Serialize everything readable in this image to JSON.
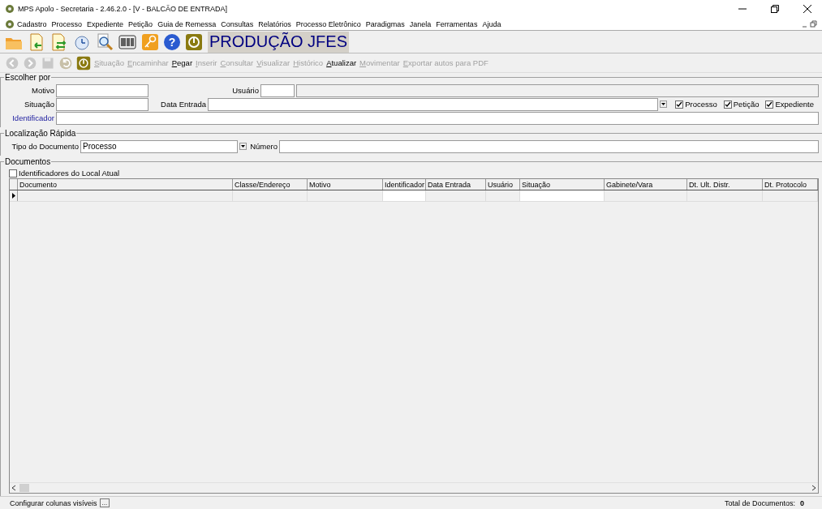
{
  "window": {
    "title": "MPS Apolo - Secretaria - 2.46.2.0 - [V - BALCÃO DE ENTRADA]"
  },
  "menu": [
    "Cadastro",
    "Processo",
    "Expediente",
    "Petição",
    "Guia de Remessa",
    "Consultas",
    "Relatórios",
    "Processo Eletrônico",
    "Paradigmas",
    "Janela",
    "Ferramentas",
    "Ajuda"
  ],
  "toolbar": {
    "help_glyph": "?",
    "banner": "PRODUÇÃO JFES"
  },
  "actions": [
    {
      "label": "Situação",
      "disabled": true
    },
    {
      "label": "Encaminhar",
      "disabled": true
    },
    {
      "label": "Pegar",
      "disabled": false
    },
    {
      "label": "Inserir",
      "disabled": true
    },
    {
      "label": "Consultar",
      "disabled": true
    },
    {
      "label": "Visualizar",
      "disabled": true
    },
    {
      "label": "Histórico",
      "disabled": true
    },
    {
      "label": "Atualizar",
      "disabled": false
    },
    {
      "label": "Movimentar",
      "disabled": true
    },
    {
      "label": "Exportar autos para PDF",
      "disabled": true
    }
  ],
  "filter": {
    "title": "Escolher por",
    "motivo": "Motivo",
    "usuario": "Usuário",
    "situacao": "Situação",
    "data_entrada": "Data Entrada",
    "identificador": "Identificador",
    "checks": [
      {
        "label": "Processo",
        "checked": true
      },
      {
        "label": "Petição",
        "checked": true
      },
      {
        "label": "Expediente",
        "checked": true
      }
    ]
  },
  "quick": {
    "title": "Localização Rápida",
    "type_label": "Tipo do Documento",
    "type_value": "Processo",
    "number_label": "Número"
  },
  "documents": {
    "title": "Documentos",
    "local_check": {
      "label": "Identificadores do Local Atual",
      "checked": false
    },
    "columns": [
      "Documento",
      "Classe/Endereço",
      "Motivo",
      "Identificador",
      "Data Entrada",
      "Usuário",
      "Situação",
      "Gabinete/Vara",
      "Dt. Ult. Distr.",
      "Dt. Protocolo"
    ]
  },
  "footer": {
    "configure": "Configurar colunas visíveis",
    "more": "...",
    "total_label": "Total de Documentos:",
    "total": "0"
  }
}
